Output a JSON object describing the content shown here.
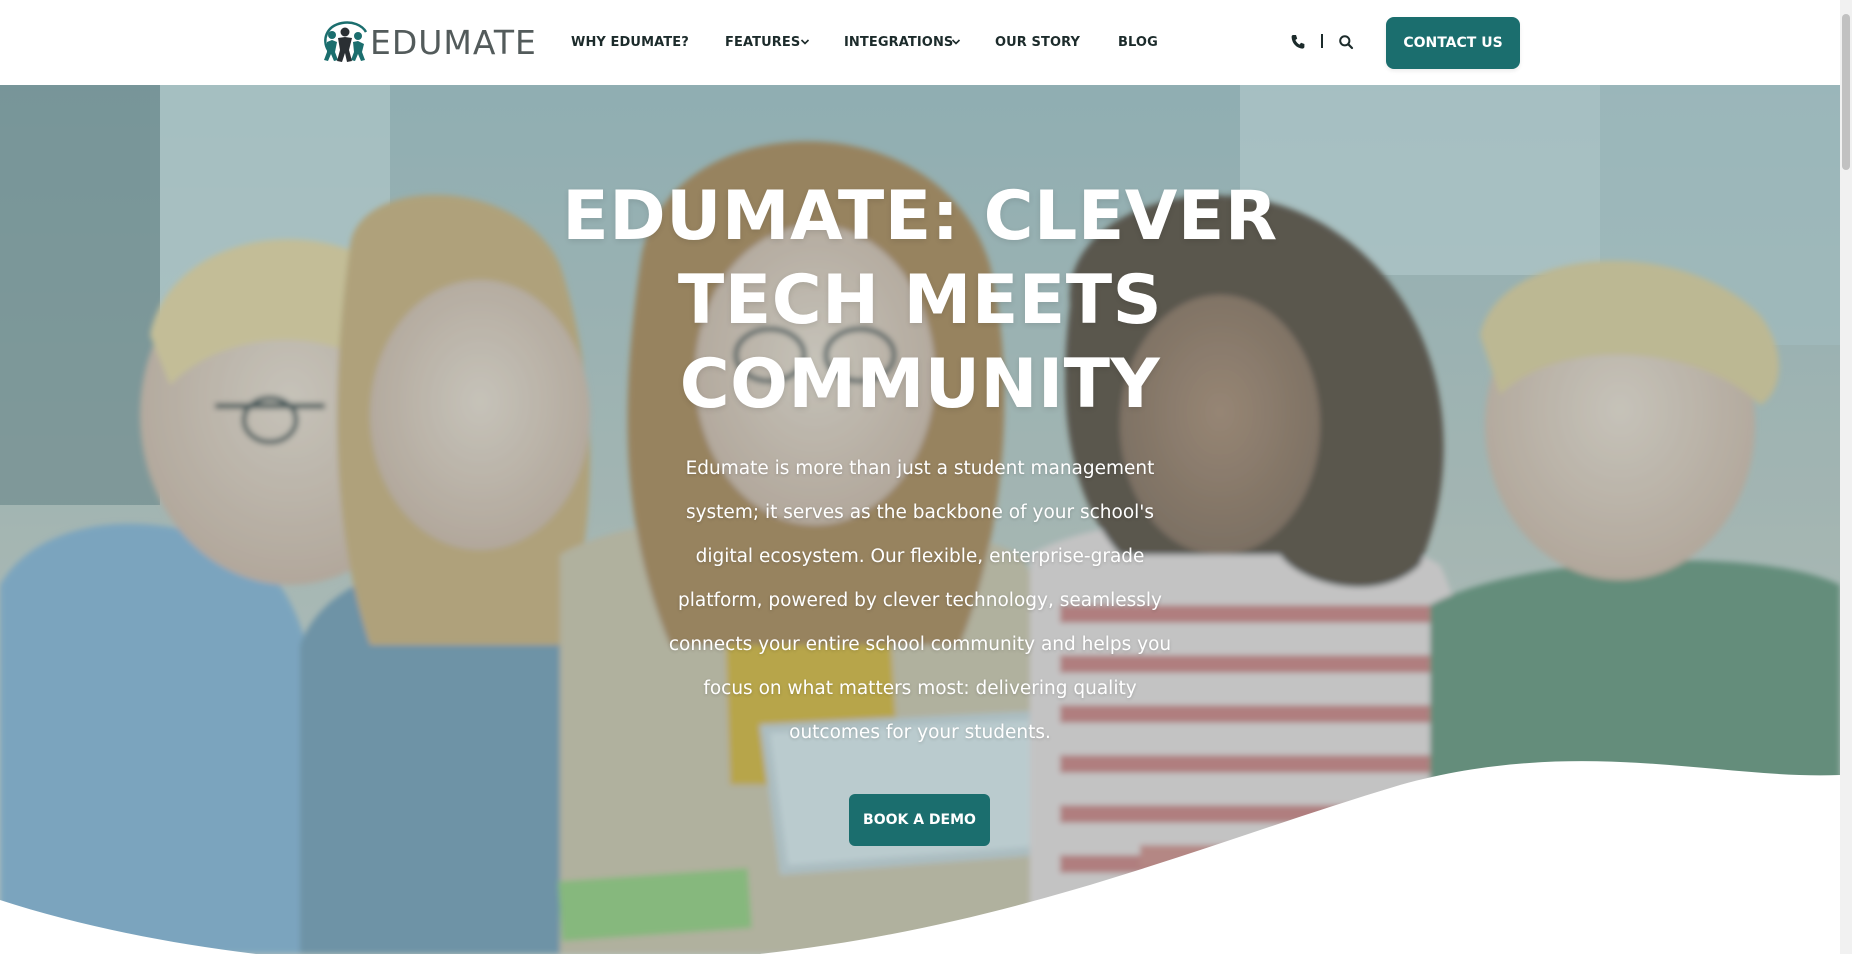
{
  "brand": {
    "name": "EDUMATE",
    "accent_color": "#1b6e6e",
    "logo_icon": "people-icon"
  },
  "nav": {
    "items": [
      {
        "label": "WHY EDUMATE?",
        "has_dropdown": false
      },
      {
        "label": "FEATURES",
        "has_dropdown": true
      },
      {
        "label": "INTEGRATIONS",
        "has_dropdown": true
      },
      {
        "label": "OUR STORY",
        "has_dropdown": false
      },
      {
        "label": "BLOG",
        "has_dropdown": false
      }
    ],
    "phone_icon": "phone-icon",
    "search_icon": "search-icon",
    "contact_label": "CONTACT US"
  },
  "hero": {
    "title": "EDUMATE: CLEVER TECH MEETS COMMUNITY",
    "description": "Edumate is more than just a student management system; it serves as the backbone of your school's digital ecosystem. Our flexible, enterprise-grade platform, powered by clever technology, seamlessly connects your entire school community and helps you focus on what matters most: delivering quality outcomes for your students.",
    "cta_label": "BOOK A DEMO"
  }
}
